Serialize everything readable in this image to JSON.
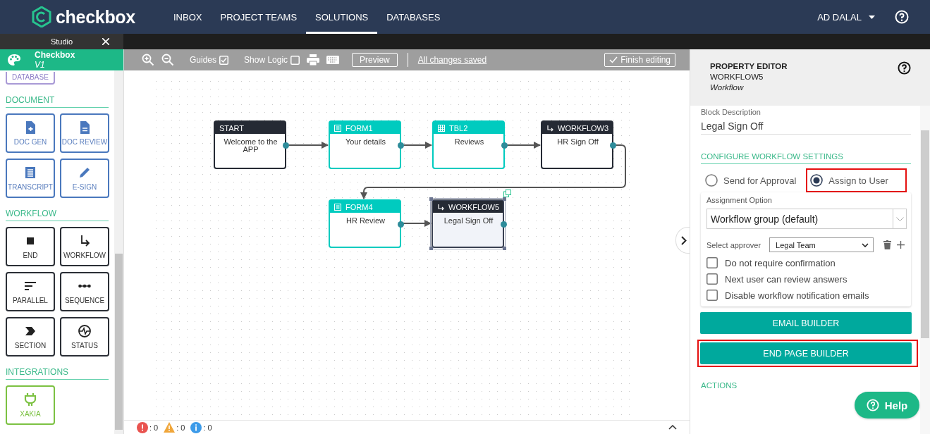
{
  "nav": {
    "logo_text": "checkbox",
    "items": [
      {
        "label": "INBOX",
        "selected": false
      },
      {
        "label": "PROJECT TEAMS",
        "selected": false
      },
      {
        "label": "SOLUTIONS",
        "selected": true
      },
      {
        "label": "DATABASES",
        "selected": false
      }
    ],
    "user": "AD DALAL"
  },
  "studio_bar": {
    "title": "Studio"
  },
  "sidebar": {
    "app_name": "Checkbox",
    "version": "V1",
    "partial_item": "DATABASE",
    "sections": [
      {
        "title": "DOCUMENT",
        "kind": "document",
        "items": [
          "DOC GEN",
          "DOC REVIEW",
          "TRANSCRIPT",
          "E-SIGN"
        ]
      },
      {
        "title": "WORKFLOW",
        "kind": "workflow",
        "items": [
          "END",
          "WORKFLOW",
          "PARALLEL",
          "SEQUENCE",
          "SECTION",
          "STATUS"
        ]
      },
      {
        "title": "INTEGRATIONS",
        "kind": "integration",
        "items": [
          "XAKIA"
        ]
      }
    ]
  },
  "toolbar": {
    "guides": {
      "label": "Guides",
      "checked": true
    },
    "show_logic": {
      "label": "Show Logic",
      "checked": false
    },
    "preview": "Preview",
    "save_status": "All changes saved",
    "finish": "Finish editing"
  },
  "canvas": {
    "nodes": [
      {
        "kind": "start",
        "title": "START",
        "body": "Welcome to the APP",
        "selected": false
      },
      {
        "kind": "form",
        "title": "FORM1",
        "body": "Your details",
        "selected": false
      },
      {
        "kind": "table",
        "title": "TBL2",
        "body": "Reviews",
        "selected": false
      },
      {
        "kind": "workflow",
        "title": "WORKFLOW3",
        "body": "HR Sign Off",
        "selected": false
      },
      {
        "kind": "form",
        "title": "FORM4",
        "body": "HR Review",
        "selected": false
      },
      {
        "kind": "workflow",
        "title": "WORKFLOW5",
        "body": "Legal Sign Off",
        "selected": true
      }
    ]
  },
  "status_bar": [
    {
      "kind": "error",
      "count": ": 0"
    },
    {
      "kind": "warning",
      "count": ": 0"
    },
    {
      "kind": "info",
      "count": ": 0"
    }
  ],
  "property_editor": {
    "title": "PROPERTY EDITOR",
    "block": "WORKFLOW5",
    "type": "Workflow",
    "description_label": "Block Description",
    "description_value": "Legal Sign Off",
    "settings_heading": "CONFIGURE WORKFLOW SETTINGS",
    "modes": [
      {
        "label": "Send for Approval",
        "selected": false,
        "highlighted": false
      },
      {
        "label": "Assign to User",
        "selected": true,
        "highlighted": true
      }
    ],
    "assignment_label": "Assignment Option",
    "assignment_value": "Workflow group (default)",
    "approver_label": "Select approver",
    "approver_value": "Legal Team",
    "options": [
      {
        "label": "Do not require confirmation",
        "checked": false
      },
      {
        "label": "Next user can review answers",
        "checked": false
      },
      {
        "label": "Disable workflow notification emails",
        "checked": false
      }
    ],
    "buttons": [
      {
        "label": "EMAIL BUILDER",
        "highlighted": false
      },
      {
        "label": "END PAGE BUILDER",
        "highlighted": true
      }
    ],
    "actions_heading": "ACTIONS"
  },
  "help_button": "Help"
}
